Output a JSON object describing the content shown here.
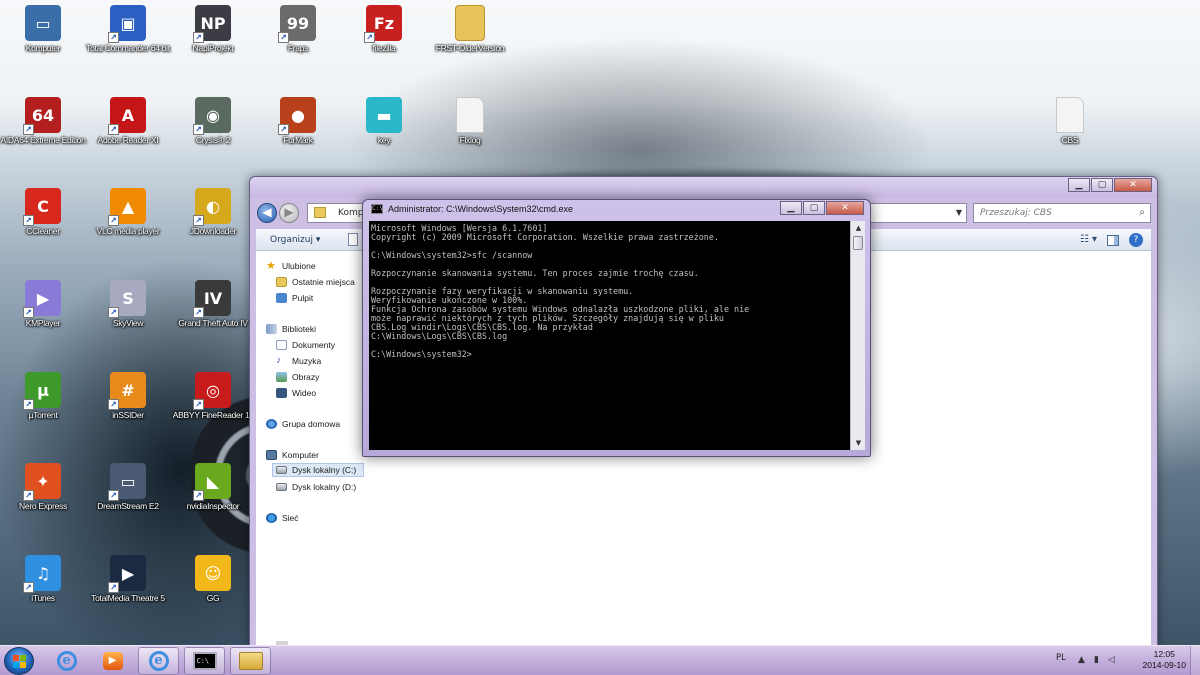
{
  "desktop_icons": [
    {
      "label": "Komputer",
      "icon": "computer-icon",
      "glyph": "▭",
      "color": "#3a6ea8"
    },
    {
      "label": "Total Commander 64 bit",
      "icon": "floppy-disk-icon",
      "glyph": "▣",
      "color": "#2b5fc2"
    },
    {
      "label": "NapiProjekt",
      "icon": "clapperboard-icon",
      "glyph": "NP",
      "color": "#3c3c44"
    },
    {
      "label": "Fraps",
      "icon": "fraps-monitor-icon",
      "glyph": "99",
      "color": "#6b6b6b"
    },
    {
      "label": "filezilla",
      "icon": "filezilla-icon",
      "glyph": "Fz",
      "color": "#c8201e"
    },
    {
      "label": "FRST-OlderVersion",
      "icon": "folder-icon",
      "glyph": "",
      "color": "#e6c45a"
    },
    {
      "label": "AIDA64 Extreme Edition",
      "icon": "aida64-icon",
      "glyph": "64",
      "color": "#b31e1e"
    },
    {
      "label": "Adobe Reader XI",
      "icon": "adobe-reader-icon",
      "glyph": "A",
      "color": "#c41616"
    },
    {
      "label": "Crysis® 2",
      "icon": "crysis-icon",
      "glyph": "◉",
      "color": "#5a6a60"
    },
    {
      "label": "FurMark",
      "icon": "furmark-icon",
      "glyph": "●",
      "color": "#b8401a"
    },
    {
      "label": "key",
      "icon": "key-file-icon",
      "glyph": "▬",
      "color": "#2ab8c8"
    },
    {
      "label": "Fixlog",
      "icon": "text-file-icon",
      "glyph": "",
      "color": "#f4f4f4"
    },
    {
      "label": "CBS",
      "icon": "text-file-icon",
      "glyph": "",
      "color": "#f4f4f4"
    },
    {
      "label": "CCleaner",
      "icon": "ccleaner-icon",
      "glyph": "C",
      "color": "#d8281e"
    },
    {
      "label": "VLC media player",
      "icon": "vlc-cone-icon",
      "glyph": "▲",
      "color": "#f08a00"
    },
    {
      "label": "JDownloader",
      "icon": "jdownloader-icon",
      "glyph": "◐",
      "color": "#d6a81c"
    },
    {
      "label": "KMPlayer",
      "icon": "kmplayer-icon",
      "glyph": "▶",
      "color": "#8a7ad8"
    },
    {
      "label": "SkyView",
      "icon": "skyview-icon",
      "glyph": "S",
      "color": "#a8a8c0"
    },
    {
      "label": "Grand Theft Auto IV",
      "icon": "gta-iv-icon",
      "glyph": "IV",
      "color": "#3a3a3a"
    },
    {
      "label": "µTorrent",
      "icon": "utorrent-icon",
      "glyph": "µ",
      "color": "#3d9a2a"
    },
    {
      "label": "inSSIDer",
      "icon": "inssider-icon",
      "glyph": "#",
      "color": "#e88a1c"
    },
    {
      "label": "ABBYY FineReader 11",
      "icon": "abbyy-icon",
      "glyph": "◎",
      "color": "#c81c1c"
    },
    {
      "label": "Nero Express",
      "icon": "nero-icon",
      "glyph": "✦",
      "color": "#e0501e"
    },
    {
      "label": "DreamStream E2",
      "icon": "laptop-icon",
      "glyph": "▭",
      "color": "#4a5a72"
    },
    {
      "label": "nvidiaInspector",
      "icon": "nvidia-icon",
      "glyph": "◣",
      "color": "#6aa81e"
    },
    {
      "label": "iTunes",
      "icon": "itunes-icon",
      "glyph": "♫",
      "color": "#2f8fe0"
    },
    {
      "label": "TotalMedia Theatre 5",
      "icon": "totalmedia-icon",
      "glyph": "▶",
      "color": "#1a2a40"
    },
    {
      "label": "GG",
      "icon": "gadu-gadu-sun-icon",
      "glyph": "☺",
      "color": "#f2b81a"
    }
  ],
  "explorer": {
    "address_fragment": "Kompu",
    "search_placeholder": "Przeszukaj: CBS",
    "organize_label": "Organizuj ▾",
    "nav": {
      "favorites": "Ulubione",
      "recent": "Ostatnie miejsca",
      "desktop": "Pulpit",
      "libraries": "Biblioteki",
      "documents": "Dokumenty",
      "music": "Muzyka",
      "pictures": "Obrazy",
      "videos": "Wideo",
      "homegroup": "Grupa domowa",
      "computer": "Komputer",
      "drive_c": "Dysk lokalny (C:)",
      "drive_d": "Dysk lokalny (D:)",
      "network": "Sieć"
    }
  },
  "cmd": {
    "title": "Administrator: C:\\Windows\\System32\\cmd.exe",
    "lines": [
      "Microsoft Windows [Wersja 6.1.7601]",
      "Copyright (c) 2009 Microsoft Corporation. Wszelkie prawa zastrzeżone.",
      "",
      "C:\\Windows\\system32>sfc /scannow",
      "",
      "Rozpoczynanie skanowania systemu. Ten proces zajmie trochę czasu.",
      "",
      "Rozpoczynanie fazy weryfikacji w skanowaniu systemu.",
      "Weryfikowanie ukończone w 100%.",
      "Funkcja Ochrona zasobów systemu Windows odnalazła uszkodzone pliki, ale nie",
      "może naprawić niektórych z tych plików. Szczegóły znajdują się w pliku",
      "CBS.Log windir\\Logs\\CBS\\CBS.log. Na przykład",
      "C:\\Windows\\Logs\\CBS\\CBS.log",
      "",
      "C:\\Windows\\system32>"
    ]
  },
  "taskbar": {
    "language": "PL",
    "time": "12:05",
    "date": "2014-09-10"
  },
  "colors": {
    "taskbar": "#c4b1dd",
    "console_bg": "#000000",
    "console_fg": "#c0c0c0"
  }
}
